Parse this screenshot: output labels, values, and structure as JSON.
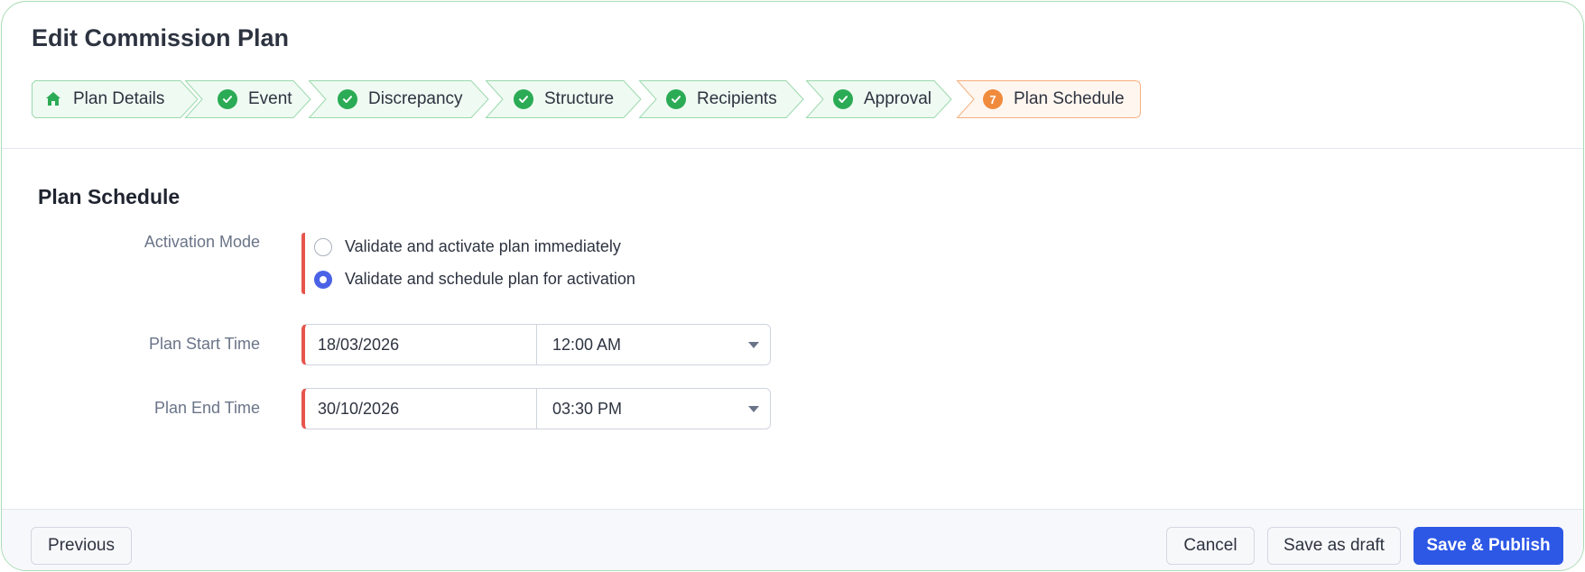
{
  "page": {
    "title": "Edit Commission Plan"
  },
  "stepper": {
    "steps": [
      {
        "label": "Plan Details",
        "status": "home",
        "icon": "home-icon"
      },
      {
        "label": "Event",
        "status": "complete",
        "icon": "check-circle-icon"
      },
      {
        "label": "Discrepancy",
        "status": "complete",
        "icon": "check-circle-icon"
      },
      {
        "label": "Structure",
        "status": "complete",
        "icon": "check-circle-icon"
      },
      {
        "label": "Recipients",
        "status": "complete",
        "icon": "check-circle-icon"
      },
      {
        "label": "Approval",
        "status": "complete",
        "icon": "check-circle-icon"
      },
      {
        "label": "Plan Schedule",
        "status": "current",
        "number": "7"
      }
    ]
  },
  "section": {
    "title": "Plan Schedule"
  },
  "activation": {
    "label": "Activation Mode",
    "options": [
      {
        "label": "Validate and activate plan immediately",
        "selected": false
      },
      {
        "label": "Validate and schedule plan for activation",
        "selected": true
      }
    ]
  },
  "start": {
    "label": "Plan Start Time",
    "date": "18/03/2026",
    "time": "12:00 AM"
  },
  "end": {
    "label": "Plan End Time",
    "date": "30/10/2026",
    "time": "03:30 PM"
  },
  "footer": {
    "previous": "Previous",
    "cancel": "Cancel",
    "save_draft": "Save as draft",
    "save_publish": "Save & Publish"
  },
  "colors": {
    "complete_fill": "#effaf2",
    "complete_border": "#9bd9ad",
    "current_fill": "#fff6ef",
    "current_border": "#f5b07e",
    "check": "#2bab55",
    "accent": "#2d58e6",
    "required": "#e6554c"
  }
}
